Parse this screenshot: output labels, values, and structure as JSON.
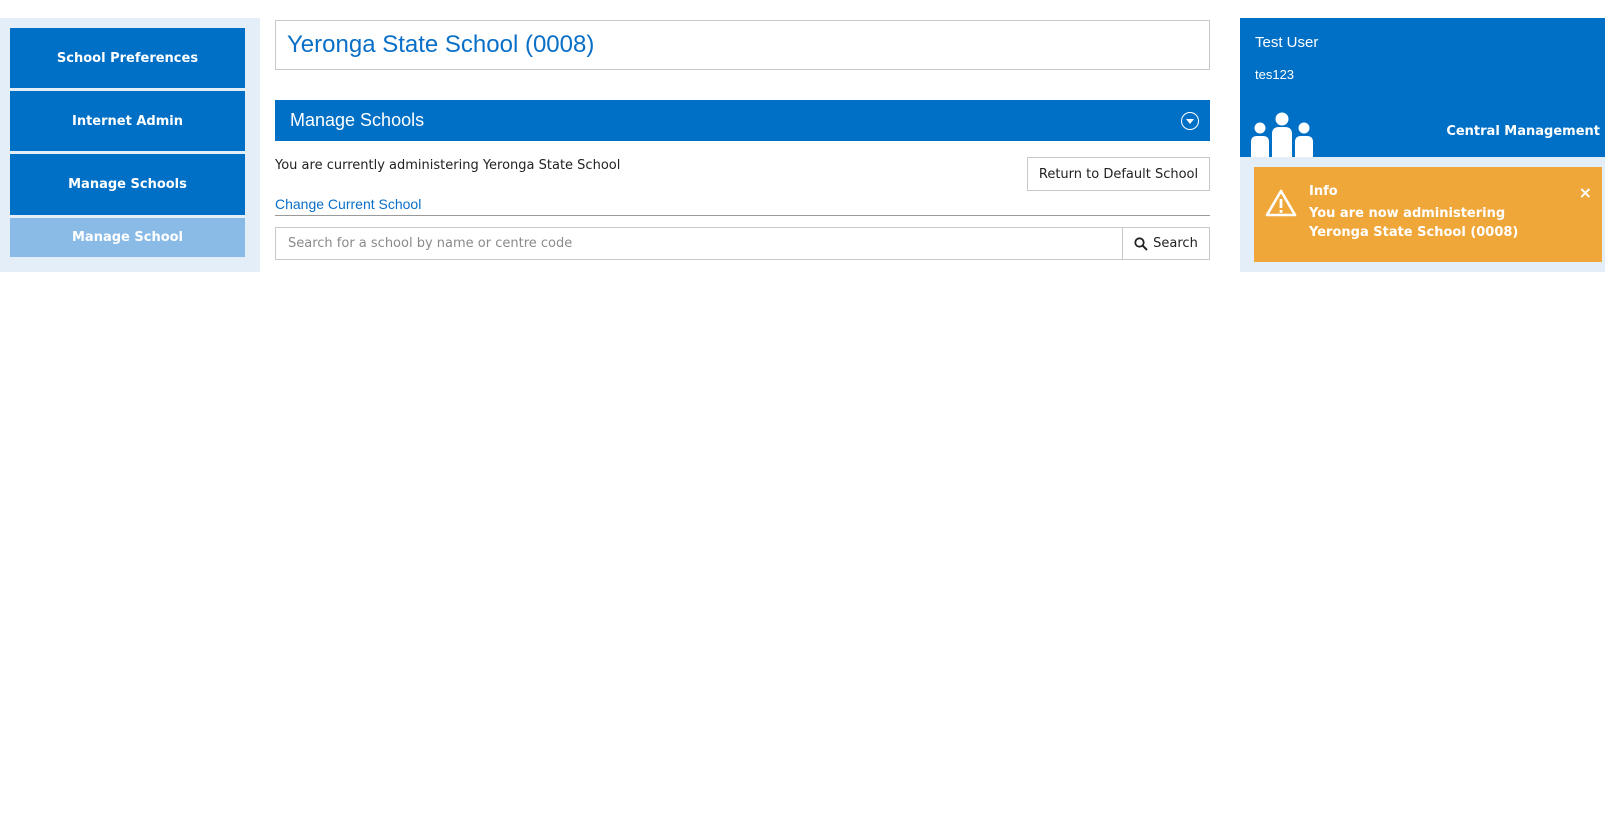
{
  "sidebar": {
    "items": [
      {
        "label": "School Preferences"
      },
      {
        "label": "Internet Admin"
      },
      {
        "label": "Manage Schools"
      },
      {
        "label": "Manage School",
        "active": true
      }
    ]
  },
  "header": {
    "school_title": "Yeronga State School (0008)"
  },
  "panel": {
    "title": "Manage Schools",
    "admin_text": "You are currently administering Yeronga State School",
    "return_button": "Return to Default School",
    "change_link": "Change Current School",
    "search": {
      "placeholder": "Search for a school by name or centre code",
      "value": "",
      "button_label": "Search"
    }
  },
  "user": {
    "name": "Test User",
    "id": "tes123",
    "role": "Central Management"
  },
  "toast": {
    "title": "Info",
    "message": "You are now administering Yeronga State School (0008)",
    "close": "×"
  },
  "colors": {
    "primary": "#0070c6",
    "sidebar_active": "#89bbe6",
    "panel_bg": "#e3eef8",
    "warning": "#f0a73a",
    "link": "#0a6fc7"
  },
  "icons": [
    "chevron-down-circle-icon",
    "search-icon",
    "people-icon",
    "warning-icon",
    "close-icon"
  ]
}
